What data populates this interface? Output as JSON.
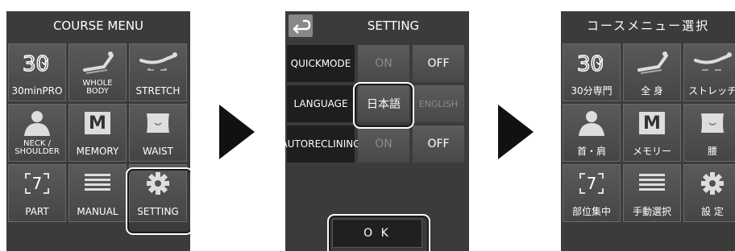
{
  "panel_en": {
    "title": "COURSE MENU",
    "tiles": [
      {
        "label": "30minPRO",
        "icon": "30min-pro-icon"
      },
      {
        "label_line1": "WHOLE",
        "label_line2": "BODY",
        "icon": "whole-body-icon"
      },
      {
        "label": "STRETCH",
        "icon": "stretch-icon"
      },
      {
        "label_line1": "NECK /",
        "label_line2": "SHOULDER",
        "icon": "neck-shoulder-icon"
      },
      {
        "label": "MEMORY",
        "icon": "memory-m-icon",
        "glyph": "M"
      },
      {
        "label": "WAIST",
        "icon": "waist-icon"
      },
      {
        "label": "PART",
        "icon": "part-icon",
        "glyph": "7"
      },
      {
        "label": "MANUAL",
        "icon": "manual-lines-icon"
      },
      {
        "label": "SETTING",
        "icon": "gear-icon"
      }
    ]
  },
  "panel_setting": {
    "title": "SETTING",
    "rows": [
      {
        "label_line1": "QUICK",
        "label_line2": "MODE",
        "opt1": "ON",
        "opt2": "OFF"
      },
      {
        "label": "LANGUAGE",
        "opt1": "日本語",
        "opt2": "ENGLISH"
      },
      {
        "label_line1": "AUTO",
        "label_line2": "RECLINING",
        "opt1": "ON",
        "opt2": "OFF"
      }
    ],
    "ok_label": "O K"
  },
  "panel_jp": {
    "title": "コースメニュー選択",
    "tiles": [
      {
        "label": "30分専門",
        "icon": "30min-pro-icon"
      },
      {
        "label": "全 身",
        "icon": "whole-body-icon"
      },
      {
        "label": "ストレッチ",
        "icon": "stretch-icon"
      },
      {
        "label": "首・肩",
        "icon": "neck-shoulder-icon"
      },
      {
        "label": "メモリー",
        "icon": "memory-m-icon",
        "glyph": "M"
      },
      {
        "label": "腰",
        "icon": "waist-icon"
      },
      {
        "label": "部位集中",
        "icon": "part-icon",
        "glyph": "7"
      },
      {
        "label": "手動選択",
        "icon": "manual-lines-icon"
      },
      {
        "label": "設 定",
        "icon": "gear-icon"
      }
    ]
  },
  "colors": {
    "panel_bg": "#3b3b3b",
    "tile_bg": "#505050",
    "highlight": "#ffffff",
    "arrow": "#111111"
  }
}
